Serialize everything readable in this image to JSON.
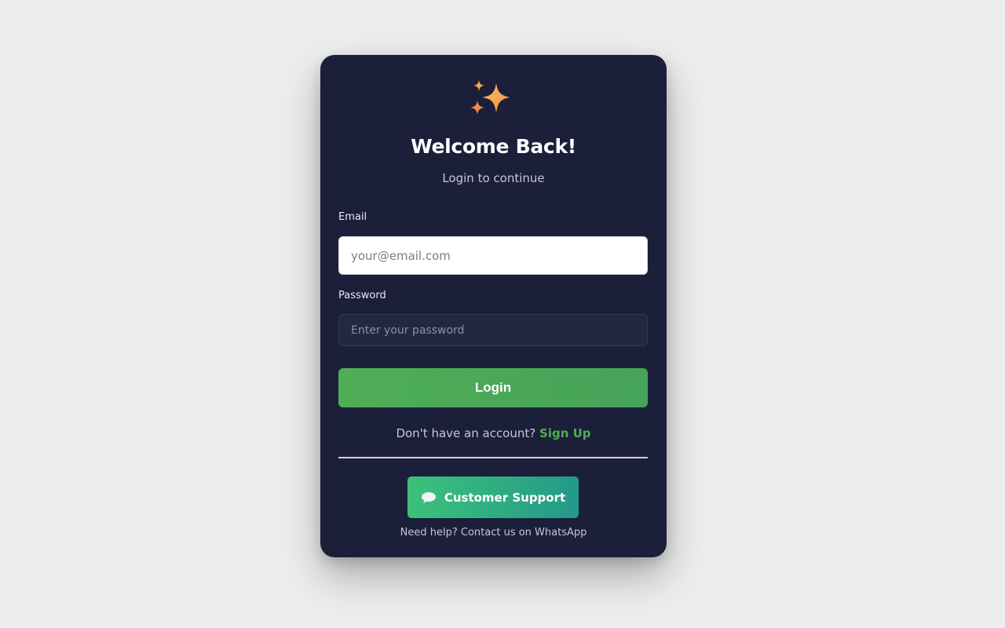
{
  "header": {
    "icon": "sparkles-icon",
    "title": "Welcome Back!",
    "subtitle": "Login to continue"
  },
  "form": {
    "email_label": "Email",
    "email_placeholder": "your@email.com",
    "password_label": "Password",
    "password_placeholder": "Enter your password",
    "login_label": "Login"
  },
  "signup": {
    "prompt": "Don't have an account?",
    "link_label": "Sign Up"
  },
  "support": {
    "icon": "chat-bubble-icon",
    "button_label": "Customer Support",
    "help_text": "Need help? Contact us on WhatsApp"
  },
  "colors": {
    "background": "#ededed",
    "card": "#1c1f3a",
    "accent_green": "#4caf50",
    "support_gradient_start": "#3cc27a",
    "support_gradient_end": "#23998a"
  }
}
